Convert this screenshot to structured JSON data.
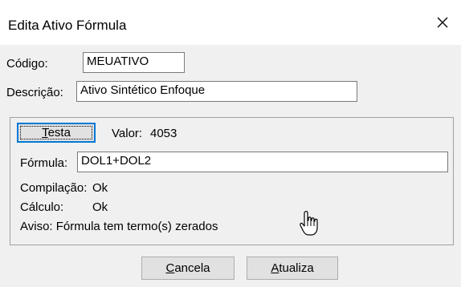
{
  "window": {
    "title": "Edita Ativo Fórmula",
    "close_glyph": "close-icon"
  },
  "form": {
    "codigo_label": "Código:",
    "codigo_value": "MEUATIVO",
    "descricao_label": "Descrição:",
    "descricao_value": "Ativo Sintético Enfoque"
  },
  "group": {
    "testa_label_mnemonic": "T",
    "testa_label_rest": "esta",
    "valor_label": "Valor:",
    "valor_value": "4053",
    "formula_label": "Fórmula:",
    "formula_value": "DOL1+DOL2",
    "compilacao_label": "Compilação:",
    "compilacao_value": "Ok",
    "calculo_label": "Cálculo:",
    "calculo_value": "Ok",
    "aviso_text": "Aviso: Fórmula tem termo(s) zerados"
  },
  "buttons": {
    "cancela_mnemonic": "C",
    "cancela_rest": "ancela",
    "atualiza_mnemonic": "A",
    "atualiza_rest": "tualiza"
  },
  "icons": [
    "close-icon",
    "hand-pointer-icon"
  ]
}
